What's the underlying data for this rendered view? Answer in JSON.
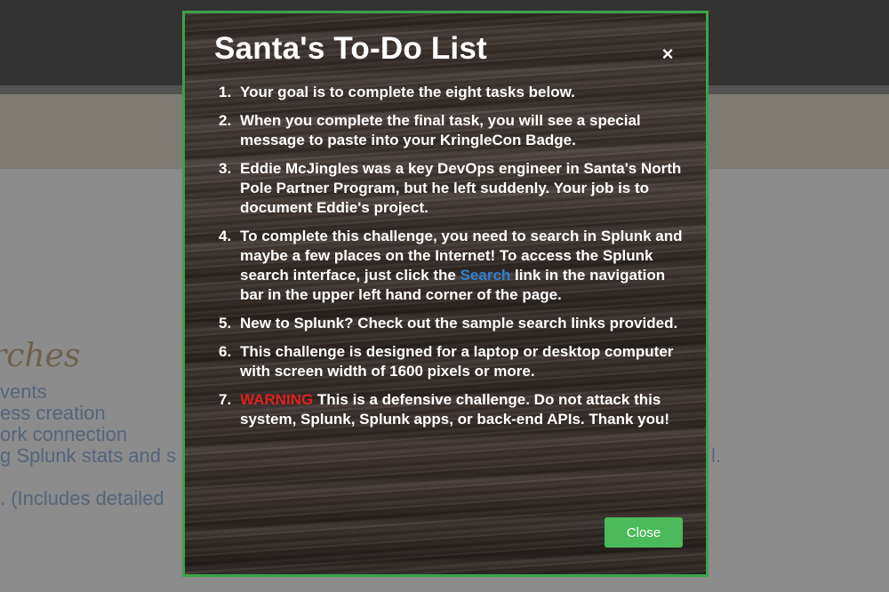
{
  "background": {
    "heading": "rches",
    "lines": [
      "vents",
      "ess creation",
      "ork connection",
      "g Splunk stats and s",
      ". (Includes detailed"
    ],
    "right_fragment": "l."
  },
  "modal": {
    "title": "Santa's To-Do List",
    "close_icon": "×",
    "close_label": "Close",
    "items": [
      {
        "num": "1.",
        "text": "Your goal is to complete the eight tasks below."
      },
      {
        "num": "2.",
        "text": "When you complete the final task, you will see a special message to paste into your KringleCon Badge."
      },
      {
        "num": "3.",
        "text": "Eddie McJingles was a key DevOps engineer in Santa's North Pole Partner Program, but he left suddenly. Your job is to document Eddie's project."
      },
      {
        "num": "4.",
        "text_before": "To complete this challenge, you need to search in Splunk and maybe a few places on the Internet! To access the Splunk search interface, just click the",
        "link": "Search",
        "text_after": "link in the navigation bar in the upper left hand corner of the page."
      },
      {
        "num": "5.",
        "text": "New to Splunk? Check out the sample search links provided."
      },
      {
        "num": "6.",
        "text": "This challenge is designed for a laptop or desktop computer with screen width of 1600 pixels or more."
      },
      {
        "num": "7.",
        "warning": "WARNING",
        "text": "This is a defensive challenge. Do not attack this system, Splunk, Splunk apps, or back-end APIs. Thank you!"
      }
    ]
  },
  "colors": {
    "modal_border": "#3aa447",
    "close_button": "#4cba5a",
    "link": "#2f7fd1",
    "warning": "#e02020"
  }
}
